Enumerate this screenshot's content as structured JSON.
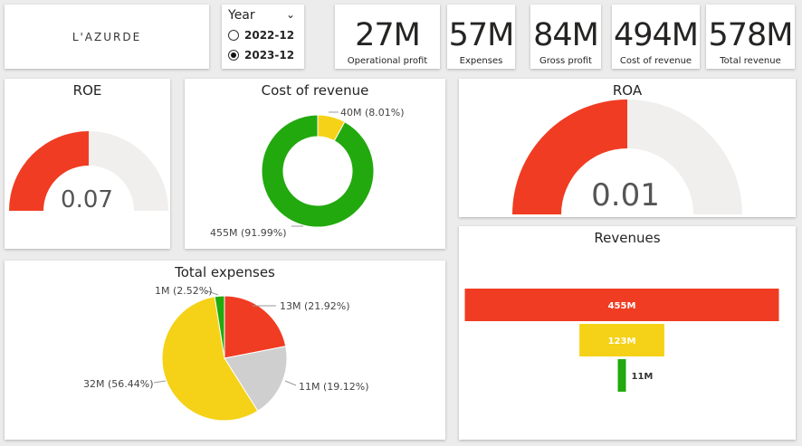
{
  "logo": "L'AZURDE",
  "slicer": {
    "title": "Year",
    "options": [
      {
        "label": "2022-12",
        "selected": false
      },
      {
        "label": "2023-12",
        "selected": true
      }
    ]
  },
  "kpis": [
    {
      "value": "27M",
      "label": "Operational profit"
    },
    {
      "value": "57M",
      "label": "Expenses"
    },
    {
      "value": "84M",
      "label": "Gross profit"
    },
    {
      "value": "494M",
      "label": "Cost of revenue"
    },
    {
      "value": "578M",
      "label": "Total revenue"
    }
  ],
  "colors": {
    "red": "#f03c22",
    "yellow": "#f5d217",
    "green": "#22a90e",
    "gray": "#cfcfcf",
    "track": "#f0efee"
  },
  "chart_data": [
    {
      "type": "gauge",
      "title": "ROE",
      "value": 0.07,
      "value_label": "0.07",
      "fill_fraction": 0.5
    },
    {
      "type": "pie",
      "subtype": "donut",
      "title": "Cost of revenue",
      "slices": [
        {
          "label": "40M (8.01%)",
          "value": 40,
          "percent": 8.01,
          "color": "#f5d217"
        },
        {
          "label": "455M (91.99%)",
          "value": 455,
          "percent": 91.99,
          "color": "#22a90e"
        }
      ]
    },
    {
      "type": "gauge",
      "title": "ROA",
      "value": 0.01,
      "value_label": "0.01",
      "fill_fraction": 0.5
    },
    {
      "type": "pie",
      "title": "Total expenses",
      "slices": [
        {
          "label": "13M (21.92%)",
          "value": 13,
          "percent": 21.92,
          "color": "#f03c22"
        },
        {
          "label": "11M (19.12%)",
          "value": 11,
          "percent": 19.12,
          "color": "#cfcfcf"
        },
        {
          "label": "32M (56.44%)",
          "value": 32,
          "percent": 56.44,
          "color": "#f5d217"
        },
        {
          "label": "1M (2.52%)",
          "value": 1,
          "percent": 2.52,
          "color": "#22a90e"
        }
      ]
    },
    {
      "type": "funnel",
      "title": "Revenues",
      "stages": [
        {
          "label": "455M",
          "value": 455,
          "color": "#f03c22"
        },
        {
          "label": "123M",
          "value": 123,
          "color": "#f5d217"
        },
        {
          "label": "11M",
          "value": 11,
          "color": "#22a90e"
        }
      ]
    }
  ]
}
